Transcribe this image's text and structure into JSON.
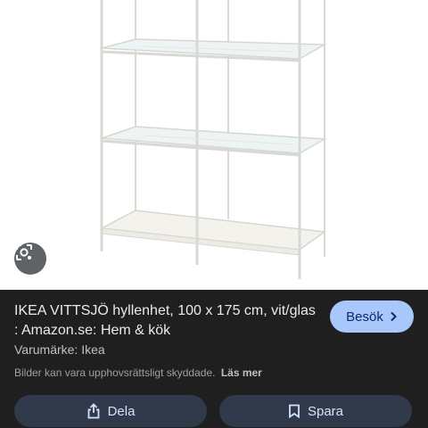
{
  "result": {
    "title": "IKEA VITTSJÖ hyllenhet, 100 x 175 cm, vit/glas : Amazon.se: Hem & kök",
    "brand": "Varumärke: Ikea",
    "copyright_notice": "Bilder kan vara upphovsrättsligt skyddade.",
    "learn_more": "Läs mer"
  },
  "buttons": {
    "visit": "Besök",
    "share": "Dela",
    "save": "Spara"
  },
  "icons": {
    "lens": "lens-icon",
    "visit": "chevron-right-icon",
    "share": "share-icon",
    "save": "bookmark-icon"
  },
  "colors": {
    "background": "#1f1f1f",
    "visit_button": "#a8c7fa",
    "action_button": "#303a4b"
  }
}
